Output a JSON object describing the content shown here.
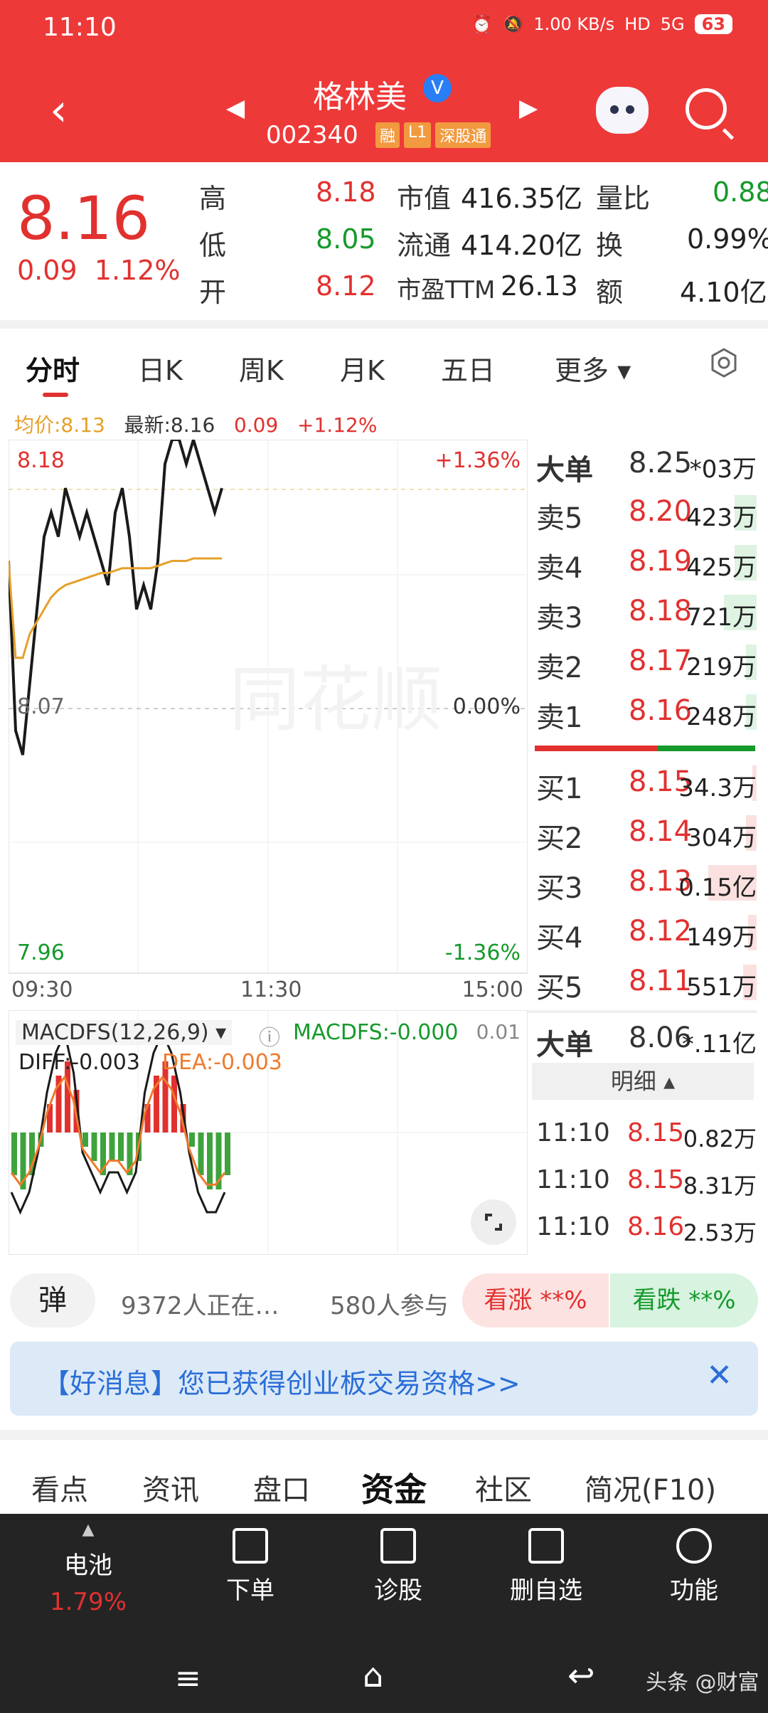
{
  "status_bar": {
    "time": "11:10",
    "net_speed": "1.00 KB/s",
    "hd": "HD",
    "signal": "5G",
    "battery": "63"
  },
  "header": {
    "stock_name": "格林美",
    "verified_badge": "V",
    "stock_code": "002340",
    "tags": [
      "融",
      "L1",
      "深股通"
    ]
  },
  "quote": {
    "price": "8.16",
    "change": "0.09",
    "change_pct": "1.12%",
    "stats": [
      {
        "label": "高",
        "value": "8.18"
      },
      {
        "label": "低",
        "value": "8.05"
      },
      {
        "label": "开",
        "value": "8.12"
      },
      {
        "label": "市值",
        "value": "416.35亿"
      },
      {
        "label": "流通",
        "value": "414.20亿"
      },
      {
        "label": "市盈TTM",
        "value": "26.13"
      },
      {
        "label": "量比",
        "value": "0.88"
      },
      {
        "label": "换",
        "value": "0.99%"
      },
      {
        "label": "额",
        "value": "4.10亿"
      }
    ]
  },
  "tabs": [
    "分时",
    "日K",
    "周K",
    "月K",
    "五日",
    "更多"
  ],
  "chart_legend": {
    "avg_label": "均价:8.13",
    "latest_label": "最新:8.16",
    "change": "0.09",
    "change_pct": "+1.12%"
  },
  "chart_data": {
    "type": "line",
    "x_ticks": [
      "09:30",
      "11:30",
      "15:00"
    ],
    "y_labels": {
      "top": "8.18",
      "mid": "8.07",
      "bottom": "7.96"
    },
    "pct_labels": {
      "top": "+1.36%",
      "mid": "0.00%",
      "bottom": "-1.36%"
    },
    "ylim": [
      7.96,
      8.18
    ],
    "series": [
      {
        "name": "最新",
        "color": "#1a1a1a",
        "values": [
          8.13,
          8.06,
          8.05,
          8.08,
          8.11,
          8.14,
          8.15,
          8.14,
          8.16,
          8.15,
          8.14,
          8.15,
          8.14,
          8.13,
          8.12,
          8.15,
          8.16,
          8.14,
          8.11,
          8.12,
          8.11,
          8.13,
          8.17,
          8.18,
          8.18,
          8.17,
          8.18,
          8.17,
          8.16,
          8.15,
          8.16
        ]
      },
      {
        "name": "均价",
        "color": "#e5a02a",
        "values": [
          8.13,
          8.09,
          8.09,
          8.1,
          8.105,
          8.11,
          8.115,
          8.118,
          8.12,
          8.121,
          8.122,
          8.123,
          8.124,
          8.125,
          8.125,
          8.126,
          8.127,
          8.127,
          8.127,
          8.127,
          8.127,
          8.128,
          8.129,
          8.13,
          8.13,
          8.13,
          8.131,
          8.131,
          8.131,
          8.131,
          8.131
        ]
      }
    ]
  },
  "macd": {
    "title": "MACDFS(12,26,9)",
    "value_label": "MACDFS:-0.000",
    "diff_label": "DIFF:-0.003",
    "dea_label": "DEA:-0.003",
    "scale_label": "0.01",
    "hist": [
      -0.003,
      -0.004,
      -0.003,
      -0.001,
      0.002,
      0.004,
      0.005,
      0.003,
      -0.001,
      -0.002,
      -0.003,
      -0.002,
      -0.002,
      -0.003,
      -0.002,
      0.002,
      0.004,
      0.005,
      0.004,
      0.002,
      -0.001,
      -0.003,
      -0.004,
      -0.004,
      -0.003
    ]
  },
  "order_book": {
    "big_sell": {
      "label": "大单",
      "price": "8.25",
      "vol": "*03万"
    },
    "asks": [
      {
        "label": "卖5",
        "price": "8.20",
        "vol": "423万"
      },
      {
        "label": "卖4",
        "price": "8.19",
        "vol": "425万"
      },
      {
        "label": "卖3",
        "price": "8.18",
        "vol": "721万"
      },
      {
        "label": "卖2",
        "price": "8.17",
        "vol": "219万"
      },
      {
        "label": "卖1",
        "price": "8.16",
        "vol": "248万"
      }
    ],
    "bids": [
      {
        "label": "买1",
        "price": "8.15",
        "vol": "34.3万"
      },
      {
        "label": "买2",
        "price": "8.14",
        "vol": "304万"
      },
      {
        "label": "买3",
        "price": "8.13",
        "vol": "0.15亿"
      },
      {
        "label": "买4",
        "price": "8.12",
        "vol": "149万"
      },
      {
        "label": "买5",
        "price": "8.11",
        "vol": "551万"
      }
    ],
    "big_buy": {
      "label": "大单",
      "price": "8.06",
      "vol": "*.11亿"
    },
    "detail_label": "明细",
    "trades": [
      {
        "time": "11:10",
        "price": "8.15",
        "vol": "0.82万"
      },
      {
        "time": "11:10",
        "price": "8.15",
        "vol": "8.31万"
      },
      {
        "time": "11:10",
        "price": "8.16",
        "vol": "2.53万"
      }
    ]
  },
  "danmu": {
    "btn": "弹",
    "watching": "9372人正在…",
    "participants": "580人参与",
    "up_label": "看涨 **%",
    "down_label": "看跌 **%"
  },
  "banner": {
    "text": "【好消息】您已获得创业板交易资格>>"
  },
  "bottom_tabs": [
    "看点",
    "资讯",
    "盘口",
    "资金",
    "社区",
    "简况(F10)"
  ],
  "nav": [
    {
      "label": "电池",
      "value": "1.79%"
    },
    {
      "label": "下单"
    },
    {
      "label": "诊股"
    },
    {
      "label": "删自选"
    },
    {
      "label": "功能"
    }
  ],
  "watermark": "头条 @财富"
}
